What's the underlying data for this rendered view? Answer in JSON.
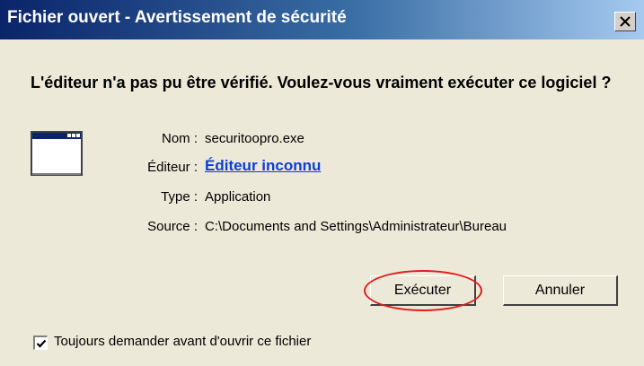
{
  "window": {
    "title": "Fichier ouvert - Avertissement de sécurité"
  },
  "question": "L'éditeur n'a pas pu être vérifié. Voulez-vous vraiment exécuter ce logiciel ?",
  "details": {
    "name_label": "Nom :",
    "name_value": "securitoopro.exe",
    "publisher_label": "Éditeur :",
    "publisher_value": "Éditeur inconnu",
    "type_label": "Type :",
    "type_value": "Application",
    "source_label": "Source :",
    "source_value": "C:\\Documents and Settings\\Administrateur\\Bureau"
  },
  "buttons": {
    "run_label": "Exécuter",
    "cancel_label": "Annuler"
  },
  "checkbox": {
    "label": "Toujours demander avant d'ouvrir ce fichier",
    "checked": true
  },
  "icons": {
    "close": "close-icon",
    "app": "application-window-icon",
    "check": "checkmark-icon"
  },
  "colors": {
    "titlebar_start": "#0a246a",
    "titlebar_end": "#a6caf0",
    "link": "#0a3ed8",
    "highlight_ellipse": "#e21b1b",
    "dialog_bg": "#ece9d8"
  }
}
